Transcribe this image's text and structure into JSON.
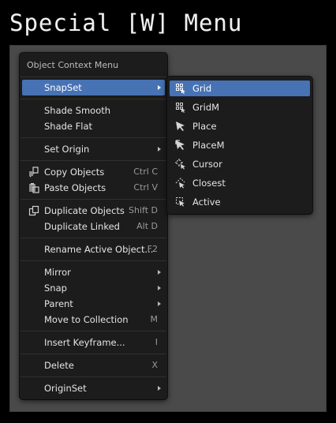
{
  "title": "Special [W] Menu",
  "context_menu": {
    "header": "Object Context Menu",
    "items": [
      {
        "label": "SnapSet",
        "submenu": true
      },
      {
        "label": "Shade Smooth"
      },
      {
        "label": "Shade Flat"
      },
      {
        "label": "Set Origin",
        "submenu": true
      },
      {
        "label": "Copy Objects",
        "shortcut": "Ctrl C",
        "icon": "copy-icon"
      },
      {
        "label": "Paste Objects",
        "shortcut": "Ctrl V",
        "icon": "paste-icon"
      },
      {
        "label": "Duplicate Objects",
        "shortcut": "Shift D",
        "icon": "duplicate-icon"
      },
      {
        "label": "Duplicate Linked",
        "shortcut": "Alt D"
      },
      {
        "label": "Rename Active Object...",
        "shortcut": "F2"
      },
      {
        "label": "Mirror",
        "submenu": true
      },
      {
        "label": "Snap",
        "submenu": true
      },
      {
        "label": "Parent",
        "submenu": true
      },
      {
        "label": "Move to Collection",
        "shortcut": "M"
      },
      {
        "label": "Insert Keyframe...",
        "shortcut": "I"
      },
      {
        "label": "Delete",
        "shortcut": "X"
      },
      {
        "label": "OriginSet",
        "submenu": true
      }
    ]
  },
  "snap_submenu": {
    "items": [
      {
        "label": "Grid",
        "icon": "snap-grid-icon"
      },
      {
        "label": "GridM",
        "icon": "snap-grid-m-icon"
      },
      {
        "label": "Place",
        "icon": "snap-place-icon"
      },
      {
        "label": "PlaceM",
        "icon": "snap-place-m-icon"
      },
      {
        "label": "Cursor",
        "icon": "snap-cursor-icon"
      },
      {
        "label": "Closest",
        "icon": "snap-closest-icon"
      },
      {
        "label": "Active",
        "icon": "snap-active-icon"
      }
    ]
  },
  "colors": {
    "highlight": "#4772b3",
    "menu_bg": "#1c1c1c",
    "viewport_bg": "#4a4a4a"
  }
}
